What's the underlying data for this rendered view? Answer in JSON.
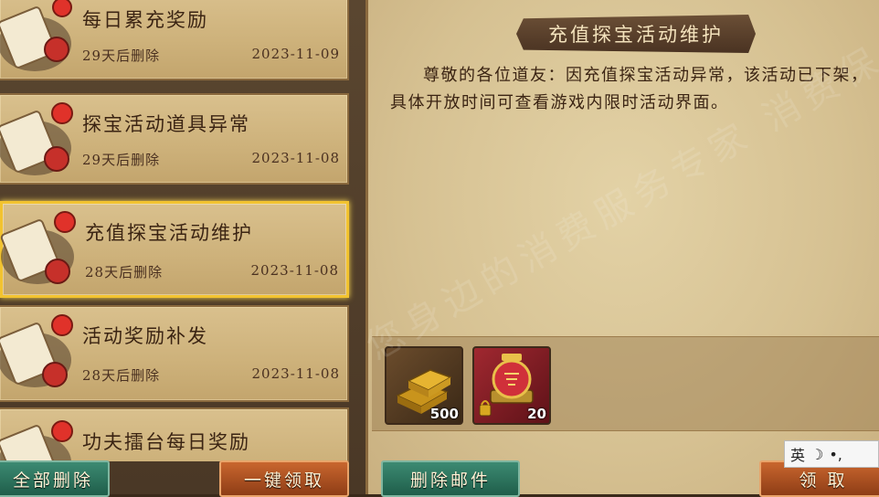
{
  "mail_list": [
    {
      "title": "每日累充奖励",
      "expire": "29天后删除",
      "date": "2023-11-09",
      "selected": false
    },
    {
      "title": "探宝活动道具异常",
      "expire": "29天后删除",
      "date": "2023-11-08",
      "selected": false
    },
    {
      "title": "充值探宝活动维护",
      "expire": "28天后删除",
      "date": "2023-11-08",
      "selected": true
    },
    {
      "title": "活动奖励补发",
      "expire": "28天后删除",
      "date": "2023-11-08",
      "selected": false
    },
    {
      "title": "功夫擂台每日奖励",
      "expire": "",
      "date": "",
      "selected": false
    }
  ],
  "buttons": {
    "delete_all": "全部删除",
    "claim_all": "一键领取",
    "delete_mail": "删除邮件",
    "claim": "领 取"
  },
  "detail": {
    "title": "充值探宝活动维护",
    "body": "尊敬的各位道友：因充值探宝活动异常，该活动已下架，具体开放时间可查看游戏内限时活动界面。"
  },
  "rewards": [
    {
      "icon": "gold-bars-icon",
      "count": "500"
    },
    {
      "icon": "red-scroll-chest-icon",
      "count": "20"
    }
  ],
  "watermark": "您身边的消费服务专家 消费保",
  "ime": {
    "lang": "英",
    "moon": "☽",
    "punct": "•,"
  }
}
